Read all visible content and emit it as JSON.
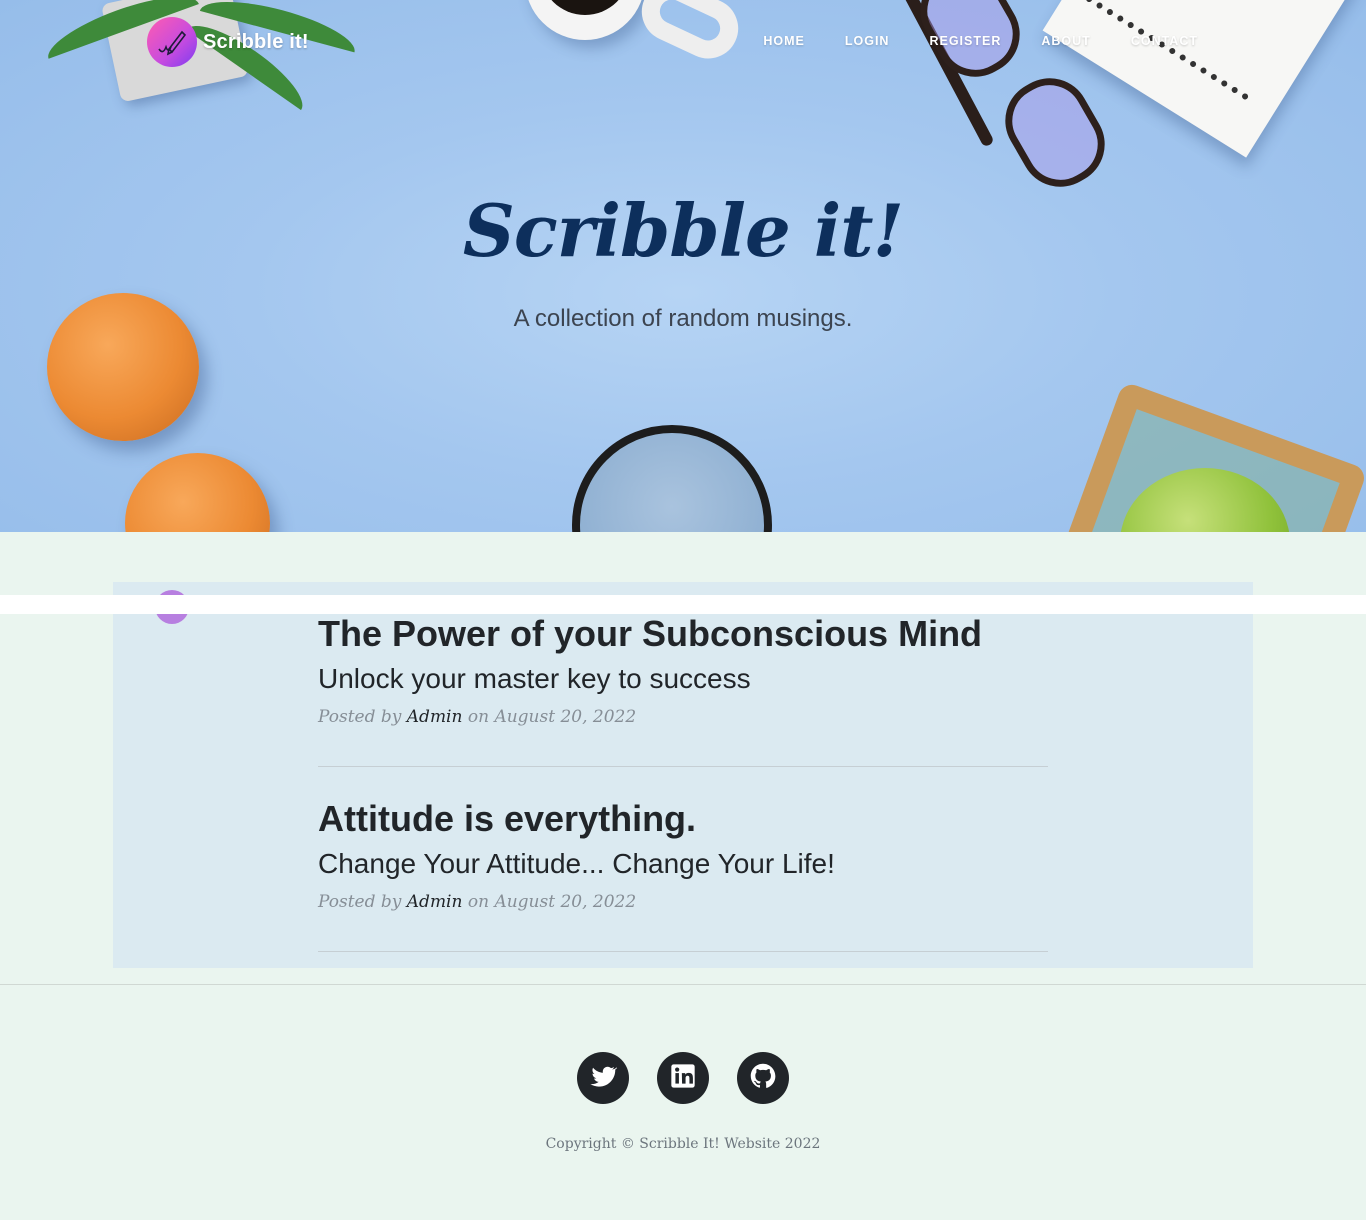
{
  "navbar": {
    "brand": "Scribble it!",
    "links": [
      "HOME",
      "LOGIN",
      "REGISTER",
      "ABOUT",
      "CONTACT"
    ]
  },
  "hero": {
    "title": "Scribble it!",
    "subtitle": "A collection of random musings."
  },
  "posts": [
    {
      "title": "The Power of your Subconscious Mind",
      "subtitle": "Unlock your master key to success",
      "posted_by_label": "Posted by",
      "author": "Admin",
      "on_label": "on",
      "date": "August 20, 2022"
    },
    {
      "title": "Attitude is everything.",
      "subtitle": "Change Your Attitude... Change Your Life!",
      "posted_by_label": "Posted by",
      "author": "Admin",
      "on_label": "on",
      "date": "August 20, 2022"
    }
  ],
  "footer": {
    "social_icons": [
      "twitter-icon",
      "linkedin-icon",
      "github-icon"
    ],
    "copyright": "Copyright © Scribble It! Website 2022"
  },
  "colors": {
    "hero_bg": "#a4c7ef",
    "hero_title": "#0d2f5c",
    "page_bg": "#eaf5ef",
    "posts_bg": "#dbeaf1",
    "text_dark": "#212529",
    "meta_gray": "#868e96"
  }
}
